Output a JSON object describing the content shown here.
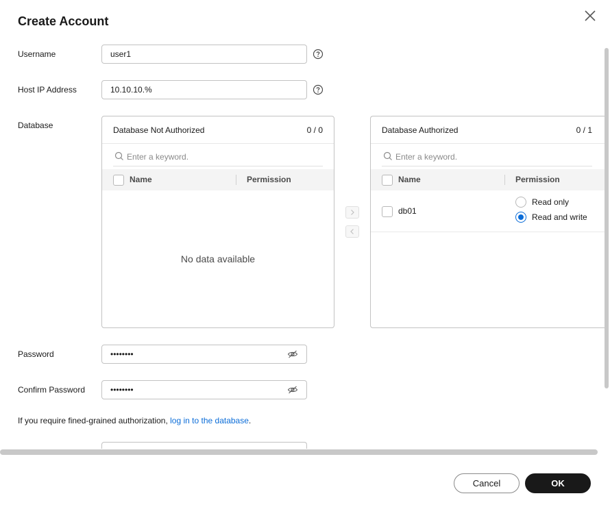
{
  "dialog": {
    "title": "Create Account"
  },
  "form": {
    "username_label": "Username",
    "username_value": "user1",
    "host_label": "Host IP Address",
    "host_value": "10.10.10.%",
    "database_label": "Database",
    "password_label": "Password",
    "password_value": "••••••••",
    "confirm_password_label": "Confirm Password",
    "confirm_password_value": "••••••••"
  },
  "left_panel": {
    "title": "Database Not Authorized",
    "count": "0 / 0",
    "search_placeholder": "Enter a keyword.",
    "col_name": "Name",
    "col_permission": "Permission",
    "empty_text": "No data available"
  },
  "right_panel": {
    "title": "Database Authorized",
    "count": "0 / 1",
    "search_placeholder": "Enter a keyword.",
    "col_name": "Name",
    "col_permission": "Permission",
    "rows": [
      {
        "name": "db01",
        "options": [
          {
            "label": "Read only",
            "selected": false
          },
          {
            "label": "Read and write",
            "selected": true
          }
        ]
      }
    ]
  },
  "transfer": {
    "to_right_icon": "chevron-right-icon",
    "to_left_icon": "chevron-left-icon"
  },
  "note": {
    "text": "If you require fined-grained authorization, ",
    "link": "log in to the database",
    "suffix": "."
  },
  "footer": {
    "cancel_label": "Cancel",
    "ok_label": "OK"
  },
  "colors": {
    "accent": "#0a6cd8",
    "primary_button": "#191919"
  }
}
